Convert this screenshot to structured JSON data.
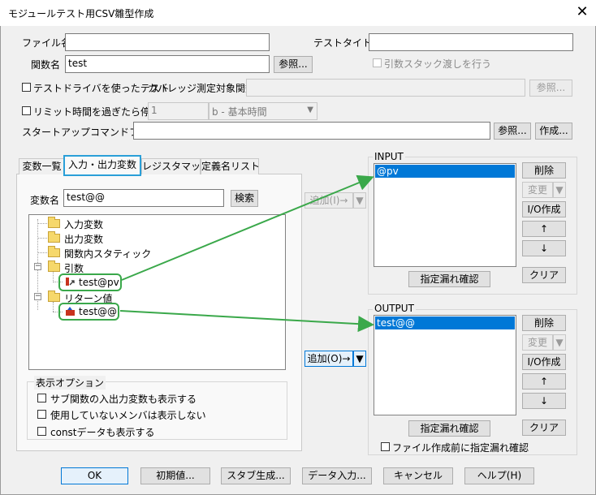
{
  "window": {
    "title": "モジュールテスト用CSV雛型作成",
    "close_glyph": "✕"
  },
  "fields": {
    "file_name_label": "ファイル名",
    "file_name_value": "",
    "test_title_label": "テストタイトル",
    "test_title_value": "",
    "func_name_label": "関数名",
    "func_name_value": "test",
    "browse_label": "参照...",
    "arg_stack_label": "引数スタック渡しを行う",
    "test_driver_label": "テストドライバを使ったテスト",
    "coverage_label": "カバレッジ測定対象関数",
    "coverage_value": "",
    "coverage_browse_label": "参照...",
    "timeout_label": "リミット時間を過ぎたら停止",
    "timeout_value": "1",
    "timeout_unit": "b - 基本時間",
    "startup_label": "スタートアップコマンドファイル:",
    "startup_value": "",
    "startup_browse_label": "参照...",
    "startup_create_label": "作成..."
  },
  "tabs": [
    "変数一覧",
    "入力・出力変数",
    "レジスタマップ",
    "定義名リスト"
  ],
  "var_panel": {
    "var_name_label": "変数名",
    "var_name_value": "test@@",
    "search_label": "検索",
    "tree": {
      "input_vars": "入力変数",
      "output_vars": "出力変数",
      "static_vars": "関数内スタティック",
      "args": "引数",
      "arg_item": "test@pv",
      "return_value": "リターン値",
      "return_item": "test@@"
    },
    "options_label": "表示オプション",
    "opt1": "サブ関数の入出力変数も表示する",
    "opt2": "使用していないメンバは表示しない",
    "opt3": "constデータも表示する"
  },
  "add_input_label": "追加(I)→",
  "add_output_label": "追加(O)→",
  "input_group": {
    "label": "INPUT",
    "items": [
      "@pv"
    ],
    "delete": "削除",
    "change": "変更",
    "io_create": "I/O作成",
    "up": "↑",
    "down": "↓",
    "clear": "クリア",
    "check": "指定漏れ確認"
  },
  "output_group": {
    "label": "OUTPUT",
    "items": [
      "test@@"
    ],
    "delete": "削除",
    "change": "変更",
    "io_create": "I/O作成",
    "up": "↑",
    "down": "↓",
    "clear": "クリア",
    "check": "指定漏れ確認",
    "check_before_create": "ファイル作成前に指定漏れ確認"
  },
  "footer": {
    "ok": "OK",
    "initial": "初期値...",
    "stub": "スタブ生成...",
    "data_input": "データ入力...",
    "cancel": "キャンセル",
    "help": "ヘルプ(H)"
  },
  "colors": {
    "selection": "#0078d7",
    "annotation": "#3aa84a",
    "tab_highlight": "#2a9fd8"
  }
}
